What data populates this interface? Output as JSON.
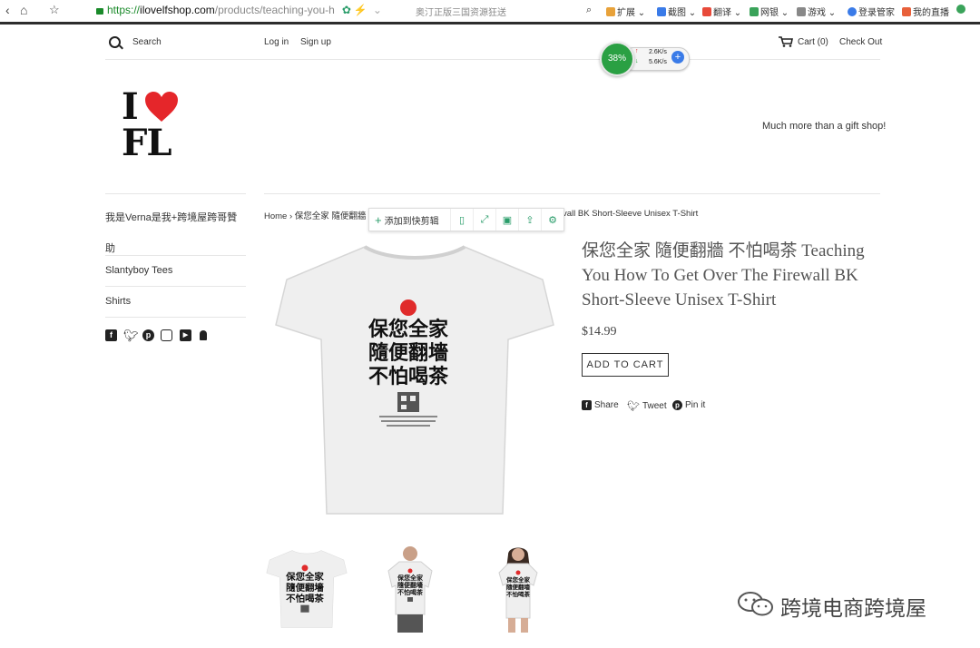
{
  "browser": {
    "url_scheme": "https://",
    "url_domain": "ilovelfshop.com",
    "url_path": "/products/teaching-you-h",
    "extra_search": "奥汀正版三国资源狂送",
    "extensions": [
      {
        "label": "扩展",
        "color": "#e8a23a"
      },
      {
        "label": "截图",
        "color": "#3a7be8"
      },
      {
        "label": "翻译",
        "color": "#e84a3a"
      },
      {
        "label": "网银",
        "color": "#3aa35a"
      },
      {
        "label": "游戏",
        "color": "#888888"
      },
      {
        "label": "登录管家",
        "color": "#3a7be8"
      },
      {
        "label": "我的直播",
        "color": "#e8603a"
      }
    ]
  },
  "header": {
    "search_label": "Search",
    "login": "Log in",
    "signup": "Sign up",
    "cart": "Cart (0)",
    "checkout": "Check Out"
  },
  "speed_widget": {
    "percent": "38%",
    "up": "2.6K/s",
    "down": "5.6K/s"
  },
  "logo": {
    "line1": "I",
    "line2": "FL"
  },
  "tagline": "Much more than a gift shop!",
  "sidebar": {
    "items": [
      {
        "label": "我是Verna是我+跨境屋跨哥贊助"
      },
      {
        "label": "Slantyboy Tees"
      },
      {
        "label": "Shirts"
      }
    ]
  },
  "breadcrumb": {
    "home": "Home",
    "sep": "›",
    "left_part": "保您全家 隨便翻牆",
    "right_part": "vall BK Short-Sleeve Unisex T-Shirt"
  },
  "clip_toolbar": {
    "label": "添加到快剪辑"
  },
  "product": {
    "title": "保您全家 隨便翻牆 不怕喝茶 Teaching You How To Get Over The Firewall BK Short-Sleeve Unisex T-Shirt",
    "price": "$14.99",
    "add_to_cart": "ADD TO CART",
    "share": "Share",
    "tweet": "Tweet",
    "pin": "Pin it"
  },
  "shirt_print": {
    "line1": "保您全家",
    "line2": "隨便翻墻",
    "line3": "不怕喝茶"
  },
  "watermark": "跨境电商跨境屋"
}
